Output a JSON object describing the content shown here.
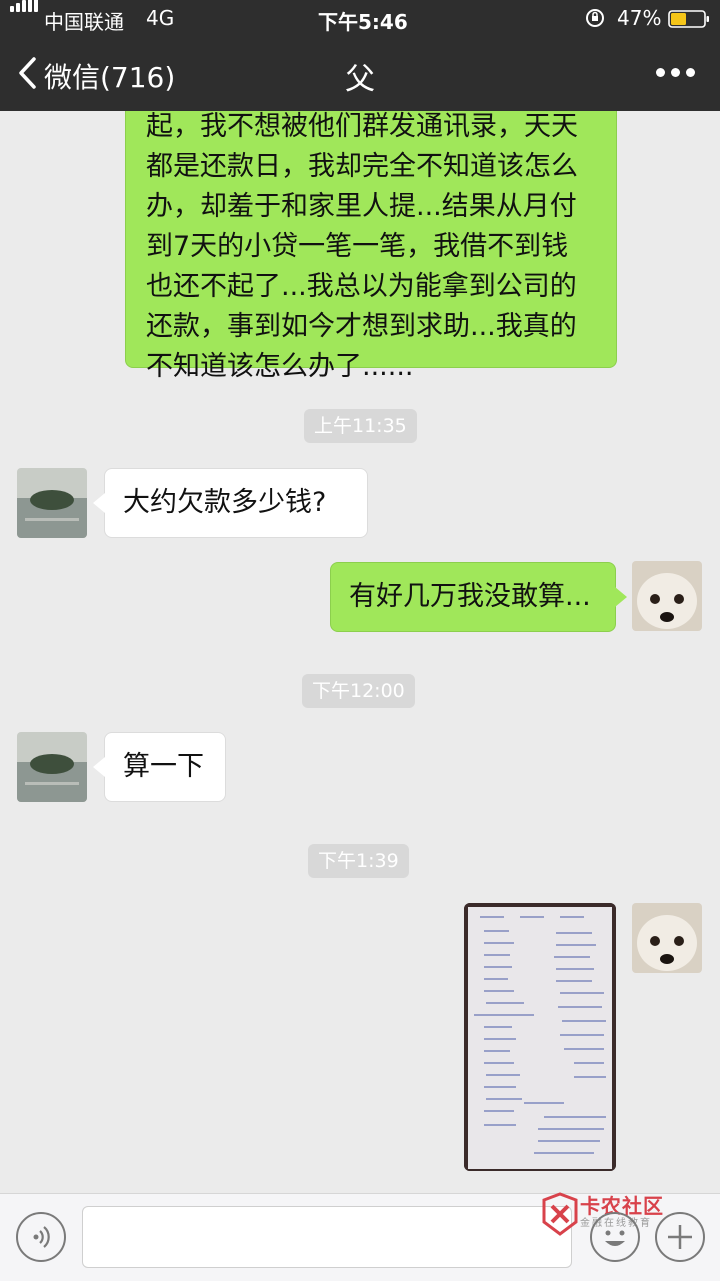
{
  "status_bar": {
    "carrier": "中国联通",
    "network": "4G",
    "time": "下午5:46",
    "battery": "47%",
    "battery_level": 0.47
  },
  "nav": {
    "back_label": "微信(716)",
    "title": "父",
    "more_icon": "more-icon"
  },
  "messages": {
    "m1": {
      "text_lines": [
        "起，我不想被他们群发通讯录，天天",
        "都是还款日，我却完全不知道该怎么",
        "办，却羞于和家里人提...结果从月付",
        "到7天的小贷一笔一笔，我借不到钱",
        "也还不起了...我总以为能拿到公司的",
        "还款，事到如今才想到求助...我真的",
        "不知道该怎么办了......"
      ]
    },
    "ts1": "上午11:35",
    "m2": "大约欠款多少钱?",
    "m3": "有好几万我没敢算...",
    "ts2": "下午12:00",
    "m4": "算一下",
    "ts3": "下午1:39"
  },
  "input_bar": {
    "voice_icon": "voice-icon",
    "emoji_icon": "emoji-icon",
    "plus_icon": "plus-icon"
  },
  "watermark": {
    "title": "卡农社区",
    "subtitle": "金融在线教育"
  },
  "colors": {
    "header_bg": "#2e2e2e",
    "chat_bg": "#ebebeb",
    "bubble_sent": "#a0e75a",
    "bubble_received": "#ffffff",
    "watermark_red": "#d8424b"
  }
}
